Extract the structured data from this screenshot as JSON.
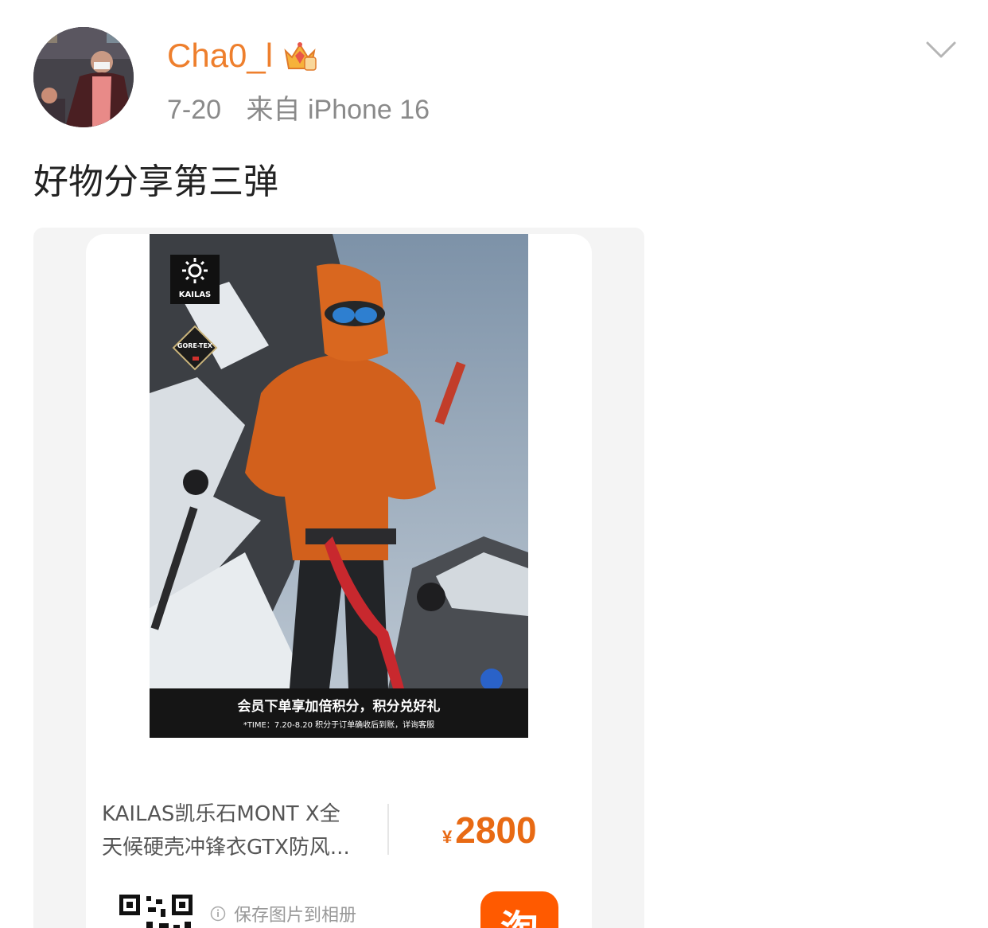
{
  "post": {
    "username": "Cha0_l",
    "date": "7-20",
    "source": "来自 iPhone 16",
    "text": "好物分享第三弹",
    "badge_icon": "crown-badge-icon",
    "menu_icon": "chevron-down-icon"
  },
  "product_card": {
    "brand": "KAILAS",
    "badge_text": "GORE-TEX",
    "banner_main": "会员下单享加倍积分，积分兑好礼",
    "banner_sub": "*TIME：7.20-8.20  积分于订单确收后到账，详询客服",
    "title_line1": "KAILAS凯乐石MONT X全",
    "title_line2": "天候硬壳冲锋衣GTX防风...",
    "price_symbol": "¥",
    "price": "2800",
    "save_hint": "保存图片到相册",
    "app_icon": "taobao-app-icon"
  },
  "colors": {
    "username": "#ee7f2d",
    "price": "#e86a14",
    "meta": "#8a8a8a",
    "app_icon_bg": "#ff5a00"
  }
}
